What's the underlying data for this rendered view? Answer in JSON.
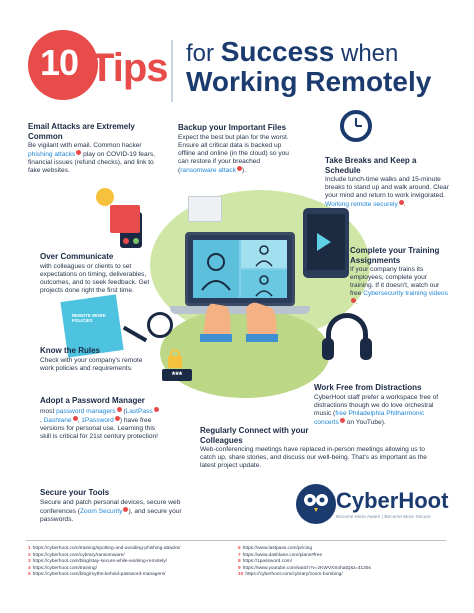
{
  "header": {
    "number": "10",
    "tips": "Tips",
    "for": "for",
    "success": "Success",
    "when": "when",
    "line2": "Working Remotely"
  },
  "tips": {
    "email": {
      "title": "Email Attacks are Extremely Common",
      "pre": "Be vigilant with email. Common hacker ",
      "link": "phishing attacks",
      "post": " play on COVID-19 fears, financial issues (refund checks), and link to fake websites."
    },
    "backup": {
      "title": "Backup your Important Files",
      "pre": "Expect the best but plan for the worst. Ensure all critical data is backed up offline and online (in the cloud) so you can restore if your breached (",
      "link": "ransomware attack",
      "post": ")."
    },
    "breaks": {
      "title": "Take Breaks and Keep a Schedule",
      "pre": "Include lunch-time walks and 15-minute breaks to stand up and walk around. Clear your mind and return to work invigorated. ",
      "link": "Working remote securely",
      "post": "."
    },
    "communicate": {
      "title": "Over Communicate",
      "body": "with colleagues or clients to set expectations on timing, deliverables, outcomes, and to seek feedback. Get projects done right the first time."
    },
    "training": {
      "title": "Complete your Training Assignments",
      "pre": "If your company trains its employees, complete your training. If it doesn't, watch our free ",
      "link": "Cybersecurity training videos",
      "post": "."
    },
    "rules": {
      "title": "Know the Rules",
      "body": "Check with your company's remote work policies and requirements."
    },
    "distractions": {
      "title": "Work Free from Distractions",
      "pre": "CyberHoot staff prefer a workspace free of distractions though we do love orchestral music (",
      "link": "free Philadelphia Philharmonic concerts",
      "post": " on YouTube)."
    },
    "password": {
      "title": "Adopt a Password Manager",
      "pre": "most ",
      "link1": "password managers",
      "mid1": " (",
      "link2": "LastPass",
      "mid2": ", ",
      "link3": "Dashlane",
      "mid3": ", ",
      "link4": "1Password",
      "post": ") have free versions for personal use. Learning this skill is critical for 21st century protection!"
    },
    "connect": {
      "title": "Regularly Connect with your Colleagues",
      "body": "Web-conferencing meetings have replaced in-person meetings allowing us to catch up, share stories, and discuss our well-being. That's as important as the latest project update."
    },
    "tools": {
      "title": "Secure your Tools",
      "pre": "Secure and patch personal devices, secure web conferences (",
      "link": "Zoom Security",
      "post": "), and secure your passwords."
    }
  },
  "illustration": {
    "book_text": "REMOTE WORK POLICIES",
    "password_mask": "***"
  },
  "logo": {
    "name": "CyberHoot",
    "tagline": "Become More Aware | Become More Secure"
  },
  "sources_left": [
    {
      "n": "1",
      "url": "https://cyberhoot.com/training/spotting-and-avoiding-phishing-attacks/"
    },
    {
      "n": "2",
      "url": "https://cyberhoot.com/cybrary/ransomware/"
    },
    {
      "n": "3",
      "url": "https://cyberhoot.com/blog/stay-secure-while-working-remotely/"
    },
    {
      "n": "4",
      "url": "https://cyberhoot.com/training/"
    },
    {
      "n": "5",
      "url": "https://cyberhoot.com/blog/myths-behind-password-managers/"
    }
  ],
  "sources_right": [
    {
      "n": "6",
      "url": "https://www.lastpass.com/pricing"
    },
    {
      "n": "7",
      "url": "https://www.dashlane.com/plans#free"
    },
    {
      "n": "8",
      "url": "https://1password.com/"
    },
    {
      "n": "9",
      "url": "https://www.youtube.com/watch?v=zKWVXSohatQ&t=4135s"
    },
    {
      "n": "10",
      "url": "https://cyberhoot.com/cybrary/zoom-bombing/"
    }
  ],
  "colors": {
    "accent_red": "#e74c4a",
    "navy": "#1b3b6f",
    "link_blue": "#1f86d6",
    "green": "#bcd887"
  }
}
